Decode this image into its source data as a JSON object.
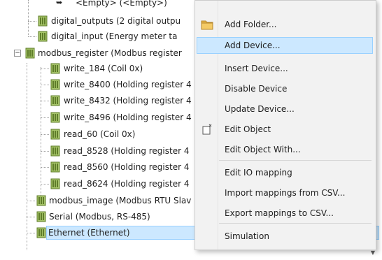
{
  "tree": {
    "partial_top": "<Empty> (<Empty>)",
    "items": [
      "digital_outputs (2 digital outpu",
      "digital_input (Energy meter ta",
      "modbus_register (Modbus register",
      "write_184 (Coil 0x)",
      "write_8400 (Holding register 4",
      "write_8432 (Holding register 4",
      "write_8496 (Holding register 4",
      "read_60 (Coil 0x)",
      "read_8528 (Holding register 4",
      "read_8560 (Holding register 4",
      "read_8624 (Holding register 4",
      "modbus_image (Modbus RTU Slav",
      "Serial (Modbus, RS-485)",
      "Ethernet (Ethernet)"
    ],
    "expander_symbol": "−"
  },
  "menu": {
    "items": [
      {
        "label": "Add Folder...",
        "icon": "folder-icon"
      },
      {
        "label": "Add Device...",
        "icon": ""
      },
      {
        "label": "Insert Device...",
        "icon": ""
      },
      {
        "label": "Disable Device",
        "icon": ""
      },
      {
        "label": "Update Device...",
        "icon": ""
      },
      {
        "label": "Edit Object",
        "icon": "edit-object-icon"
      },
      {
        "label": "Edit Object With...",
        "icon": ""
      },
      {
        "label": "Edit IO mapping",
        "icon": ""
      },
      {
        "label": "Import mappings from CSV...",
        "icon": ""
      },
      {
        "label": "Export mappings to CSV...",
        "icon": ""
      },
      {
        "label": "Simulation",
        "icon": ""
      }
    ],
    "highlighted": "Add Device..."
  },
  "colors": {
    "highlight_bg": "#cce8ff",
    "highlight_border": "#99d1ff",
    "folder": "#e8b64a",
    "device_icon": "#7a9b3e"
  }
}
